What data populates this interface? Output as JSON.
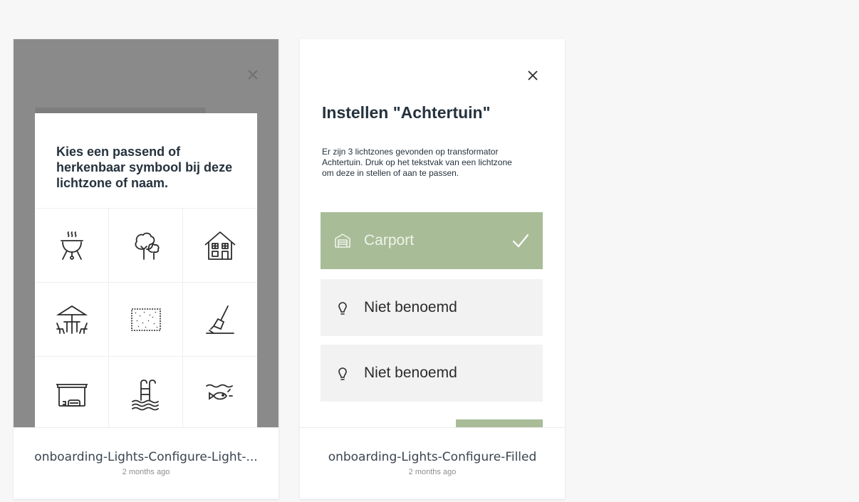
{
  "cards": [
    {
      "name": "onboarding-Lights-Configure-Light-...",
      "time": "2 months ago",
      "modal": {
        "title": "Kies een passend of herkenbaar symbool bij deze lichtzone of naam.",
        "icons": [
          "barbecue-icon",
          "trees-icon",
          "house-icon",
          "patio-table-icon",
          "lawn-icon",
          "garden-spade-icon",
          "carport-icon",
          "pool-ladder-icon",
          "pond-fish-icon"
        ]
      }
    },
    {
      "name": "onboarding-Lights-Configure-Filled",
      "time": "2 months ago",
      "screen": {
        "title": "Instellen \"Achtertuin\"",
        "description": "Er zijn 3 lichtzones gevonden op transformator Achtertuin. Druk op het tekstvak van een lichtzone om deze in stellen of aan te passen.",
        "zones": [
          {
            "label": "Carport",
            "icon": "garage-icon",
            "selected": true
          },
          {
            "label": "Niet benoemd",
            "icon": "lightbulb-icon",
            "selected": false
          },
          {
            "label": "Niet benoemd",
            "icon": "lightbulb-icon",
            "selected": false
          }
        ]
      }
    }
  ],
  "colors": {
    "accent": "#a8bc98",
    "text_dark": "#25323d",
    "overlay": "#8a8a8a",
    "page_bg": "#f7f7f8"
  }
}
